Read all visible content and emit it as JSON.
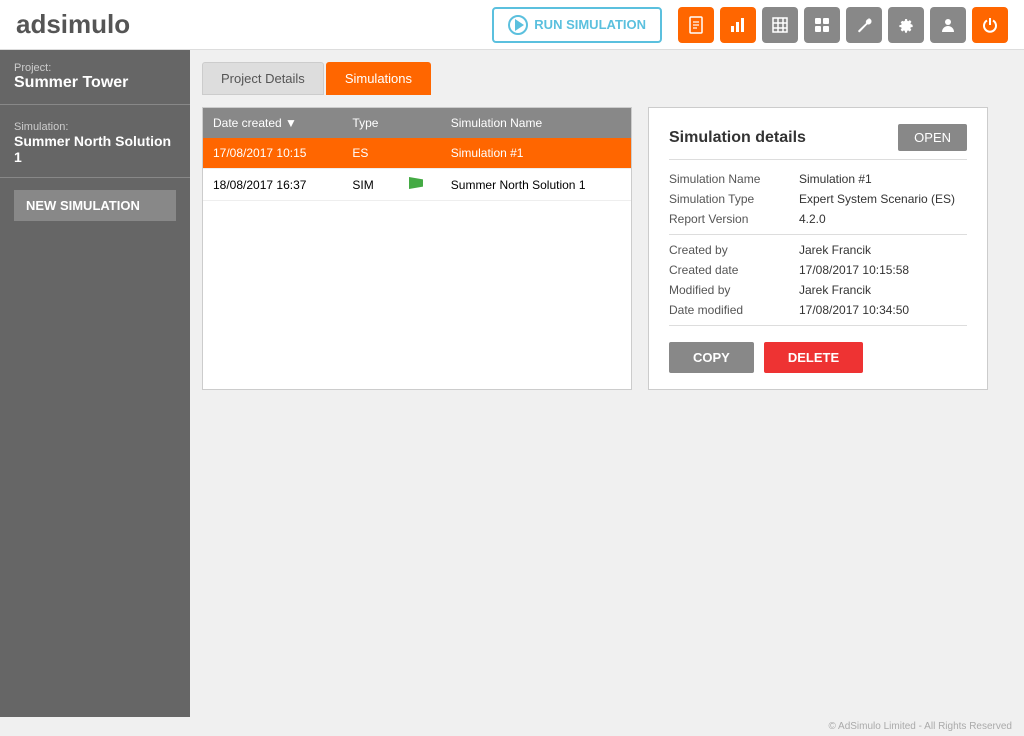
{
  "header": {
    "logo_ad": "ad",
    "logo_simulo": "simulo",
    "run_simulation_label": "RUN SIMULATION",
    "toolbar_icons": [
      {
        "name": "document-icon",
        "symbol": "📄",
        "style": "orange"
      },
      {
        "name": "chart-icon",
        "symbol": "📊",
        "style": "orange"
      },
      {
        "name": "grid-lines-icon",
        "symbol": "⊞",
        "style": "grey"
      },
      {
        "name": "tiles-icon",
        "symbol": "⊟",
        "style": "grey"
      },
      {
        "name": "wrench-icon",
        "symbol": "🔧",
        "style": "grey"
      },
      {
        "name": "settings-icon",
        "symbol": "⚙",
        "style": "grey"
      },
      {
        "name": "user-icon",
        "symbol": "👤",
        "style": "grey"
      },
      {
        "name": "power-icon",
        "symbol": "⏻",
        "style": "orange"
      }
    ]
  },
  "sidebar": {
    "project_label": "Project:",
    "project_name": "Summer Tower",
    "simulation_label": "Simulation:",
    "simulation_name": "Summer North Solution 1",
    "new_simulation_label": "NEW SIMULATION"
  },
  "tabs": [
    {
      "label": "Project Details",
      "active": false
    },
    {
      "label": "Simulations",
      "active": true
    }
  ],
  "table": {
    "columns": [
      "Date created ▼",
      "Type",
      "",
      "Simulation Name"
    ],
    "rows": [
      {
        "date": "17/08/2017 10:15",
        "type": "ES",
        "flag": false,
        "name": "Simulation #1",
        "selected": true
      },
      {
        "date": "18/08/2017 16:37",
        "type": "SIM",
        "flag": true,
        "name": "Summer North Solution 1",
        "selected": false
      }
    ]
  },
  "details": {
    "title": "Simulation details",
    "open_label": "OPEN",
    "fields": [
      {
        "key": "Simulation Name",
        "value": "Simulation #1"
      },
      {
        "key": "Simulation Type",
        "value": "Expert System Scenario (ES)"
      },
      {
        "key": "Report Version",
        "value": "4.2.0"
      },
      {
        "key": "Created by",
        "value": "Jarek Francik"
      },
      {
        "key": "Created date",
        "value": "17/08/2017 10:15:58"
      },
      {
        "key": "Modified by",
        "value": "Jarek Francik"
      },
      {
        "key": "Date modified",
        "value": "17/08/2017 10:34:50"
      }
    ],
    "copy_label": "COPY",
    "delete_label": "DELETE"
  },
  "footer": {
    "text": "© AdSimulo Limited - All Rights Reserved"
  }
}
